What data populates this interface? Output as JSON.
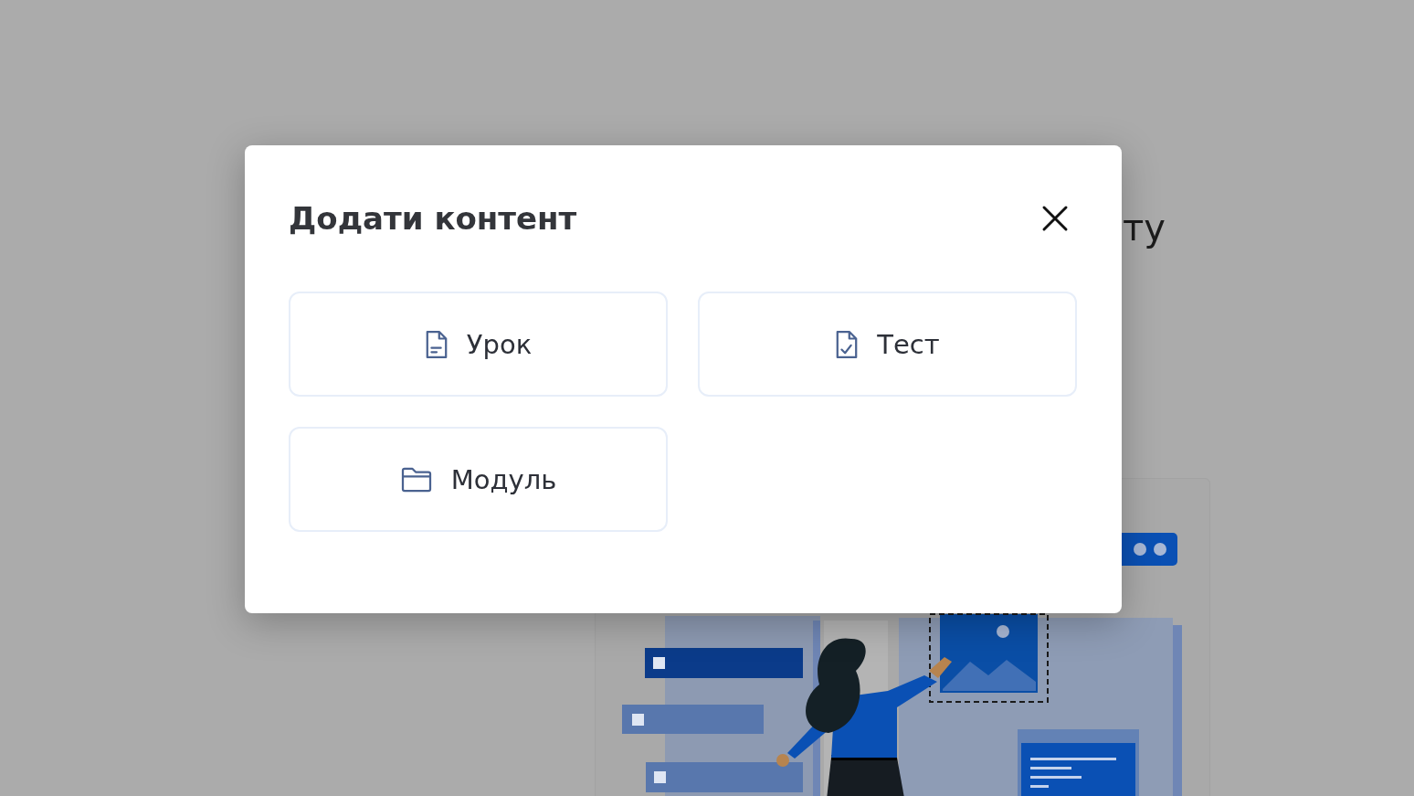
{
  "background_page": {
    "heading_fragment": "ту"
  },
  "dialog": {
    "title": "Додати контент",
    "options": [
      {
        "kind": "lesson",
        "label": "Урок"
      },
      {
        "kind": "test",
        "label": "Тест"
      },
      {
        "kind": "module",
        "label": "Модуль"
      }
    ]
  }
}
